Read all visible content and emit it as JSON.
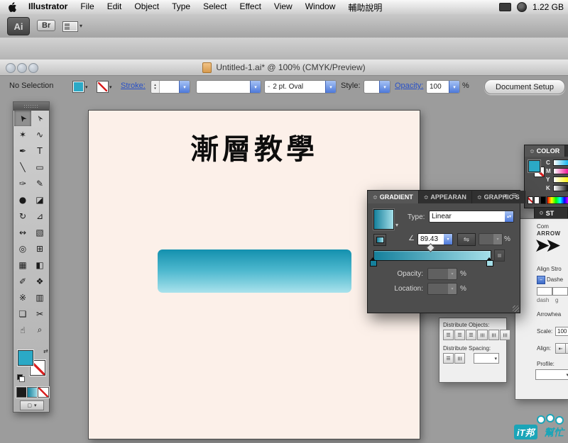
{
  "menu_bar": {
    "items": [
      "Illustrator",
      "File",
      "Edit",
      "Object",
      "Type",
      "Select",
      "Effect",
      "View",
      "Window",
      "輔助說明"
    ],
    "memory_status": "1.22 GB"
  },
  "app_bar": {
    "ai_logo": "Ai",
    "bridge_button": "Br"
  },
  "control_bar": {
    "selection_status": "No Selection",
    "stroke_link": "Stroke:",
    "brush_value": "2 pt. Oval",
    "style_label": "Style:",
    "opacity_link": "Opacity:",
    "opacity_value": "100",
    "percent": "%",
    "document_setup": "Document Setup"
  },
  "document_window": {
    "title": "Untitled-1.ai* @ 100% (CMYK/Preview)"
  },
  "artboard": {
    "heading": "漸層教學"
  },
  "colors": {
    "teal": "#2ba9c6",
    "gradient_start": "#15809c",
    "gradient_end": "#a5dfe9",
    "artboard_bg": "#fcf0e9",
    "accent_blue": "#4d79d9",
    "panel_dark": "#4d4d4d",
    "watermark_teal": "#1ba5b8"
  },
  "icons": {
    "dropdown": "▾",
    "up": "▴",
    "down": "▾",
    "swap": "⇄",
    "collapse": "≎",
    "panel_menu": "≣",
    "minimize_panel": "▾",
    "reverse": "⇋",
    "angle": "∠",
    "distribute": "☰",
    "arrowhead": "➤",
    "align_start": "⇤",
    "align_end": "⇥",
    "checkbox_dash": "–",
    "screen_square": "▢"
  },
  "tools": [
    {
      "name": "selection",
      "glyph": "➤",
      "rot": true,
      "active": true
    },
    {
      "name": "direct-selection",
      "glyph": "➢",
      "rot": true
    },
    {
      "name": "magic-wand",
      "glyph": "✶"
    },
    {
      "name": "lasso",
      "glyph": "∿"
    },
    {
      "name": "pen",
      "glyph": "✒"
    },
    {
      "name": "type",
      "glyph": "T"
    },
    {
      "name": "line-segment",
      "glyph": "╲"
    },
    {
      "name": "rectangle",
      "glyph": "▭"
    },
    {
      "name": "paintbrush",
      "glyph": "✑"
    },
    {
      "name": "pencil",
      "glyph": "✎"
    },
    {
      "name": "blob-brush",
      "glyph": "●"
    },
    {
      "name": "eraser",
      "glyph": "◪"
    },
    {
      "name": "rotate",
      "glyph": "↻"
    },
    {
      "name": "scale",
      "glyph": "⊿"
    },
    {
      "name": "width",
      "glyph": "↭"
    },
    {
      "name": "free-transform",
      "glyph": "▧"
    },
    {
      "name": "shape-builder",
      "glyph": "◎"
    },
    {
      "name": "perspective-grid",
      "glyph": "⊞"
    },
    {
      "name": "mesh",
      "glyph": "▦"
    },
    {
      "name": "gradient",
      "glyph": "◧"
    },
    {
      "name": "eyedropper",
      "glyph": "✐"
    },
    {
      "name": "blend",
      "glyph": "❖"
    },
    {
      "name": "symbol-sprayer",
      "glyph": "※"
    },
    {
      "name": "column-graph",
      "glyph": "▥"
    },
    {
      "name": "artboard",
      "glyph": "❏"
    },
    {
      "name": "slice",
      "glyph": "✂"
    },
    {
      "name": "hand",
      "glyph": "☝"
    },
    {
      "name": "zoom",
      "glyph": "⌕"
    }
  ],
  "gradient_panel": {
    "tabs": [
      {
        "label": "GRADIENT",
        "active": true
      },
      {
        "label": "APPEARAN",
        "active": false
      },
      {
        "label": "GRAPHIC S",
        "active": false
      }
    ],
    "type_label": "Type:",
    "type_value": "Linear",
    "angle_value": "89.43",
    "percent": "%",
    "opacity_label": "Opacity:",
    "location_label": "Location:"
  },
  "color_panel": {
    "title": "COLOR",
    "channels": [
      {
        "label": "C",
        "ramp_to": "#00aeef"
      },
      {
        "label": "M",
        "ramp_to": "#ec008c"
      },
      {
        "label": "Y",
        "ramp_to": "#fff200"
      },
      {
        "label": "K",
        "ramp_to": "#000000"
      }
    ]
  },
  "stroke_panel": {
    "tab_title": "ST",
    "corner_label": "Com",
    "arrow_heading": "ARROW",
    "align_stroke_label": "Align Stro",
    "dashed_label": "Dashe",
    "dash_label": "dash",
    "gap_label": "g",
    "arrowheads_label": "Arrowhea",
    "scale_label": "Scale:",
    "scale_value": "100",
    "align_label": "Align:",
    "profile_label": "Profile:"
  },
  "align_panel": {
    "distribute_objects_label": "Distribute Objects:",
    "distribute_spacing_label": "Distribute Spacing:",
    "objects_buttons": [
      {
        "name": "distribute-top-edges",
        "orient": "h"
      },
      {
        "name": "distribute-vertical-centers",
        "orient": "h"
      },
      {
        "name": "distribute-bottom-edges",
        "orient": "h"
      },
      {
        "name": "distribute-left-edges",
        "orient": "v"
      },
      {
        "name": "distribute-horizontal-centers",
        "orient": "v"
      },
      {
        "name": "distribute-right-edges",
        "orient": "v"
      }
    ],
    "spacing_buttons": [
      {
        "name": "vertical-distribute-space",
        "orient": "h"
      },
      {
        "name": "horizontal-distribute-space",
        "orient": "v"
      }
    ]
  },
  "watermark": {
    "badge": "iT邦",
    "text": "幫忙"
  }
}
